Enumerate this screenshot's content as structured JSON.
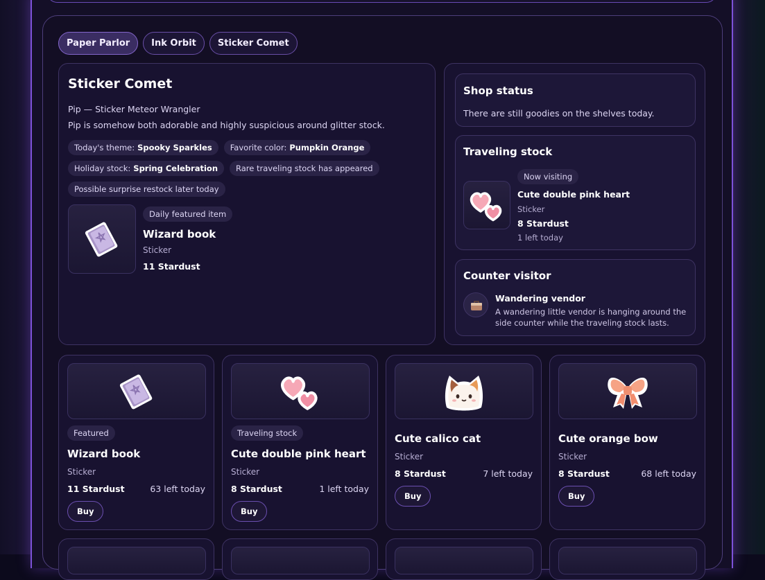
{
  "tabs": [
    {
      "label": "Paper Parlor",
      "active": true
    },
    {
      "label": "Ink Orbit",
      "active": false
    },
    {
      "label": "Sticker Comet",
      "active": false
    }
  ],
  "shop": {
    "name": "Sticker Comet",
    "keeper": "Pip — Sticker Meteor Wrangler",
    "description": "Pip is somehow both adorable and highly suspicious around glitter stock.",
    "chips": {
      "theme_label": "Today's theme:",
      "theme_value": "Spooky Sparkles",
      "color_label": "Favorite color:",
      "color_value": "Pumpkin Orange",
      "holiday_label": "Holiday stock:",
      "holiday_value": "Spring Celebration",
      "rare": "Rare traveling stock has appeared",
      "restock": "Possible surprise restock later today"
    },
    "featured": {
      "badge": "Daily featured item",
      "name": "Wizard book",
      "type": "Sticker",
      "price": "11 Stardust"
    }
  },
  "status": {
    "title": "Shop status",
    "text": "There are still goodies on the shelves today."
  },
  "traveling": {
    "title": "Traveling stock",
    "badge": "Now visiting",
    "name": "Cute double pink heart",
    "type": "Sticker",
    "price": "8 Stardust",
    "left": "1 left today"
  },
  "visitor": {
    "title": "Counter visitor",
    "name": "Wandering vendor",
    "text_line1": "A wandering little vendor is hanging around the",
    "text_line2": "side counter while the traveling stock lasts."
  },
  "products": [
    {
      "badge": "Featured",
      "name": "Wizard book",
      "type": "Sticker",
      "price": "11 Stardust",
      "left": "63 left today",
      "buy": "Buy",
      "icon": "wizard-book-icon"
    },
    {
      "badge": "Traveling stock",
      "name": "Cute double pink heart",
      "type": "Sticker",
      "price": "8 Stardust",
      "left": "1 left today",
      "buy": "Buy",
      "icon": "double-heart-icon"
    },
    {
      "badge": "",
      "name": "Cute calico cat",
      "type": "Sticker",
      "price": "8 Stardust",
      "left": "7 left today",
      "buy": "Buy",
      "icon": "calico-cat-icon"
    },
    {
      "badge": "",
      "name": "Cute orange bow",
      "type": "Sticker",
      "price": "8 Stardust",
      "left": "68 left today",
      "buy": "Buy",
      "icon": "orange-bow-icon"
    }
  ]
}
